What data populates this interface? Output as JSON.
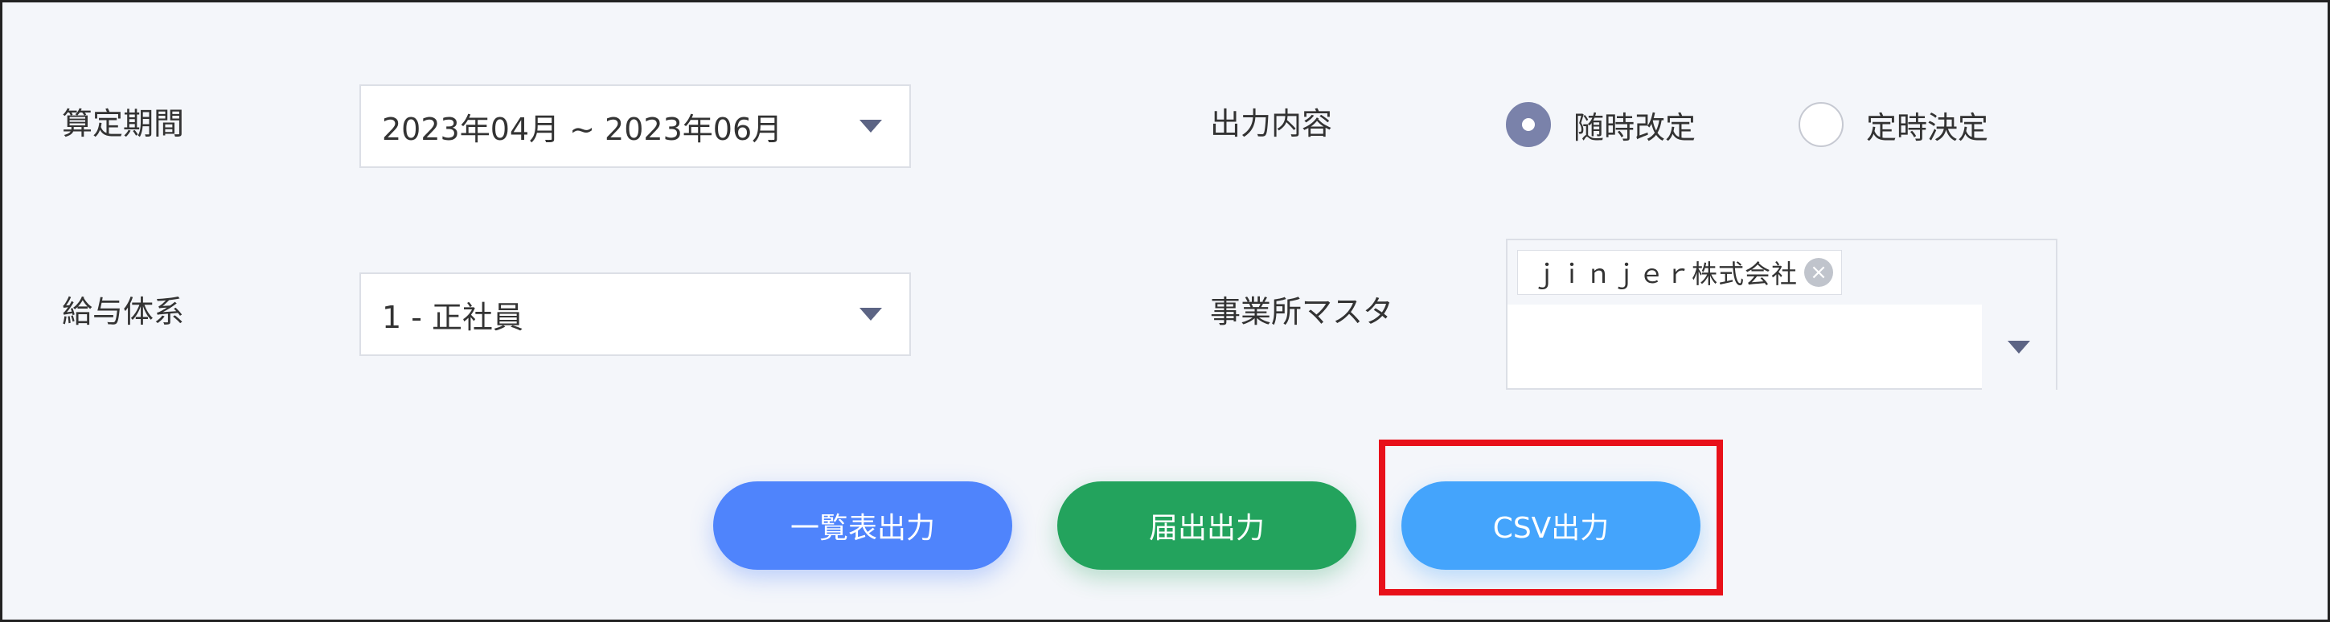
{
  "filters": {
    "period": {
      "label": "算定期間",
      "value": "2023年04月 ~ 2023年06月"
    },
    "pay_system": {
      "label": "給与体系",
      "value": "1 - 正社員"
    },
    "output_content": {
      "label": "出力内容",
      "options": [
        {
          "label": "随時改定",
          "selected": true
        },
        {
          "label": "定時決定",
          "selected": false
        }
      ]
    },
    "office_master": {
      "label": "事業所マスタ",
      "tags": [
        "ｊｉｎｊｅｒ株式会社"
      ]
    }
  },
  "actions": {
    "list_output": "一覧表出力",
    "notification_output": "届出出力",
    "csv_output": "CSV出力"
  },
  "colors": {
    "background": "#f4f6fa",
    "list_button": "#4f84fc",
    "notification_button": "#23a35d",
    "csv_button": "#44a4fc",
    "radio_checked": "#7a82aa",
    "highlight": "#e8111a"
  },
  "icons": {
    "select_caret": "caret-down-icon",
    "tag_remove": "close-circle-icon"
  }
}
